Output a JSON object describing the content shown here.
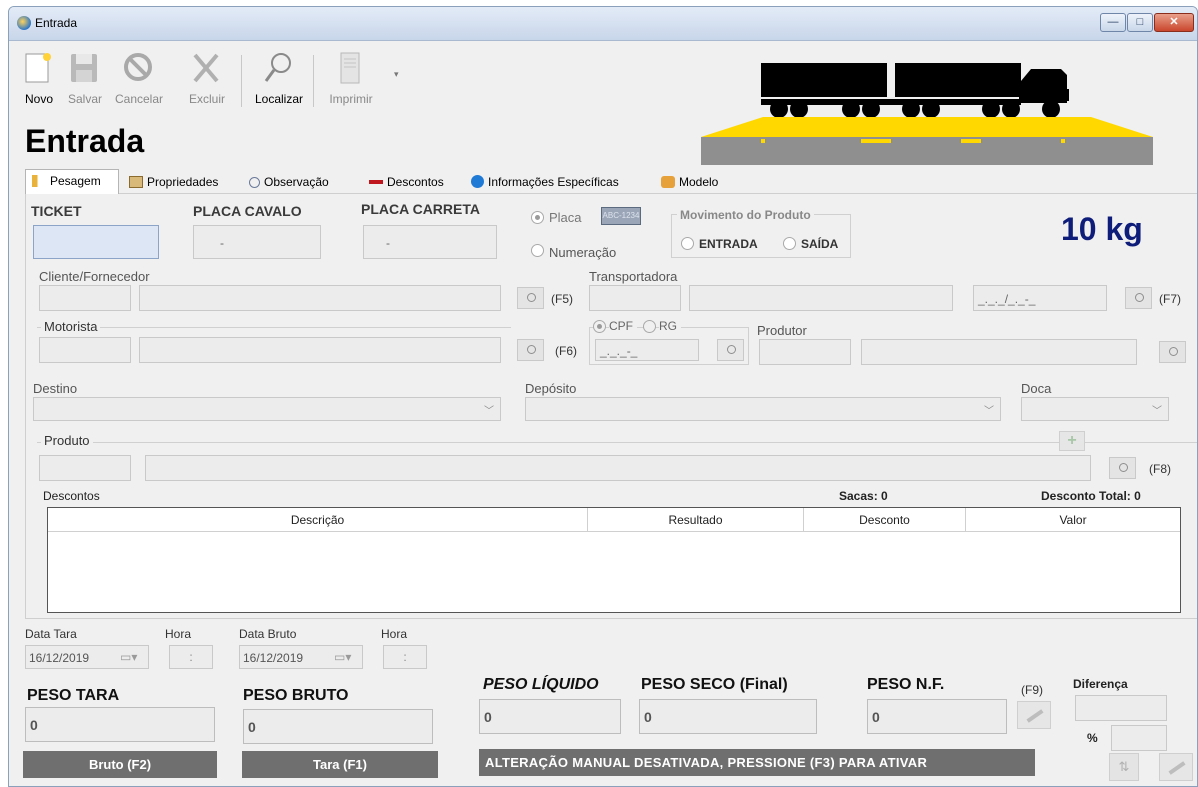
{
  "window": {
    "title": "Entrada",
    "btn_min": "—",
    "btn_max": "□",
    "btn_close": "✕"
  },
  "toolbar": {
    "novo": "Novo",
    "salvar": "Salvar",
    "cancelar": "Cancelar",
    "excluir": "Excluir",
    "localizar": "Localizar",
    "imprimir": "Imprimir"
  },
  "page_title": "Entrada",
  "tabs": [
    "Pesagem",
    "Propriedades",
    "Observação",
    "Descontos",
    "Informações Específicas",
    "Modelo"
  ],
  "form": {
    "ticket_label": "TICKET",
    "placa_cavalo_label": "PLACA CAVALO",
    "placa_cavalo_value": "-",
    "placa_carreta_label": "PLACA CARRETA",
    "placa_carreta_value": "-",
    "radio_placa": "Placa",
    "plate_badge": "ABC-1234",
    "radio_numeracao": "Numeração",
    "movimento_label": "Movimento do Produto",
    "radio_entrada": "ENTRADA",
    "radio_saida": "SAÍDA",
    "weight_display": "10 kg",
    "cliente_label": "Cliente/Fornecedor",
    "f5": "(F5)",
    "transportadora_label": "Transportadora",
    "cnpj_mask": "_._._/_._-_",
    "f7": "(F7)",
    "motorista_label": "Motorista",
    "f6": "(F6)",
    "radio_cpf": "CPF",
    "radio_rg": "RG",
    "cpf_mask": "_._._-_",
    "produtor_label": "Produtor",
    "destino_label": "Destino",
    "deposito_label": "Depósito",
    "doca_label": "Doca",
    "produto_label": "Produto",
    "f8": "(F8)",
    "descontos_label": "Descontos",
    "sacas": "Sacas: 0",
    "desconto_total": "Desconto Total: 0"
  },
  "grid": {
    "columns": [
      "Descrição",
      "Resultado",
      "Desconto",
      "Valor"
    ]
  },
  "bottom": {
    "data_tara_label": "Data Tara",
    "hora1_label": "Hora",
    "data_bruto_label": "Data Bruto",
    "hora2_label": "Hora",
    "data_tara": "16/12/2019",
    "data_bruto": "16/12/2019",
    "hora_mask": ":",
    "peso_tara_label": "PESO TARA",
    "peso_tara": "0",
    "peso_bruto_label": "PESO BRUTO",
    "peso_bruto": "0",
    "peso_liquido_label": "PESO LÍQUIDO",
    "peso_liquido": "0",
    "peso_seco_label": "PESO SECO (Final)",
    "peso_seco": "0",
    "peso_nf_label": "PESO N.F.",
    "peso_nf": "0",
    "f9": "(F9)",
    "diferenca_label": "Diferença",
    "percent": "%",
    "bruto_btn": "Bruto (F2)",
    "tara_btn": "Tara (F1)",
    "status": "ALTERAÇÃO MANUAL DESATIVADA, PRESSIONE (F3) PARA ATIVAR"
  }
}
